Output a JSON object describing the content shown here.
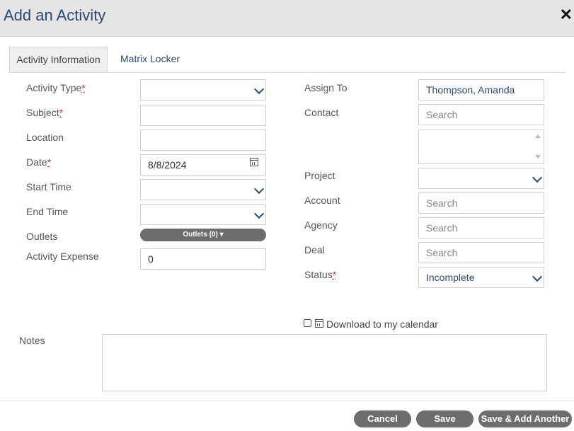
{
  "dialog": {
    "title": "Add an Activity",
    "close_symbol": "✕"
  },
  "tabs": [
    {
      "label": "Activity Information",
      "active": true
    },
    {
      "label": "Matrix Locker",
      "active": false
    }
  ],
  "left": {
    "activity_type": {
      "label": "Activity Type",
      "required_mark": "*",
      "value": ""
    },
    "subject": {
      "label": "Subject",
      "required_mark": "*",
      "value": ""
    },
    "location": {
      "label": "Location",
      "value": ""
    },
    "date": {
      "label": "Date",
      "required_mark": "*",
      "value": "8/8/2024"
    },
    "start_time": {
      "label": "Start Time",
      "value": ""
    },
    "end_time": {
      "label": "End Time",
      "value": ""
    },
    "outlets": {
      "label": "Outlets",
      "button_label": "Outlets (0) ▾"
    },
    "activity_expense": {
      "label": "Activity Expense",
      "value": "0"
    }
  },
  "right": {
    "assign_to": {
      "label": "Assign To",
      "value": "Thompson, Amanda"
    },
    "contact": {
      "label": "Contact",
      "placeholder": "Search"
    },
    "project": {
      "label": "Project",
      "value": ""
    },
    "account": {
      "label": "Account",
      "placeholder": "Search"
    },
    "agency": {
      "label": "Agency",
      "placeholder": "Search"
    },
    "deal": {
      "label": "Deal",
      "placeholder": "Search"
    },
    "status": {
      "label": "Status",
      "required_mark": "*",
      "value": "Incomplete"
    }
  },
  "download": {
    "label": "Download to my calendar",
    "checked": false
  },
  "notes": {
    "label": "Notes",
    "value": ""
  },
  "buttons": {
    "cancel": "Cancel",
    "save": "Save",
    "save_add_another": "Save & Add Another"
  },
  "colors": {
    "title": "#2c4a73",
    "button_bg": "#6d6d6d",
    "header_bg": "#e5e5e5"
  },
  "icons": [
    "close-icon",
    "chevron-down-icon",
    "calendar-icon",
    "scroll-up-icon",
    "scroll-down-icon",
    "checkbox-icon"
  ]
}
